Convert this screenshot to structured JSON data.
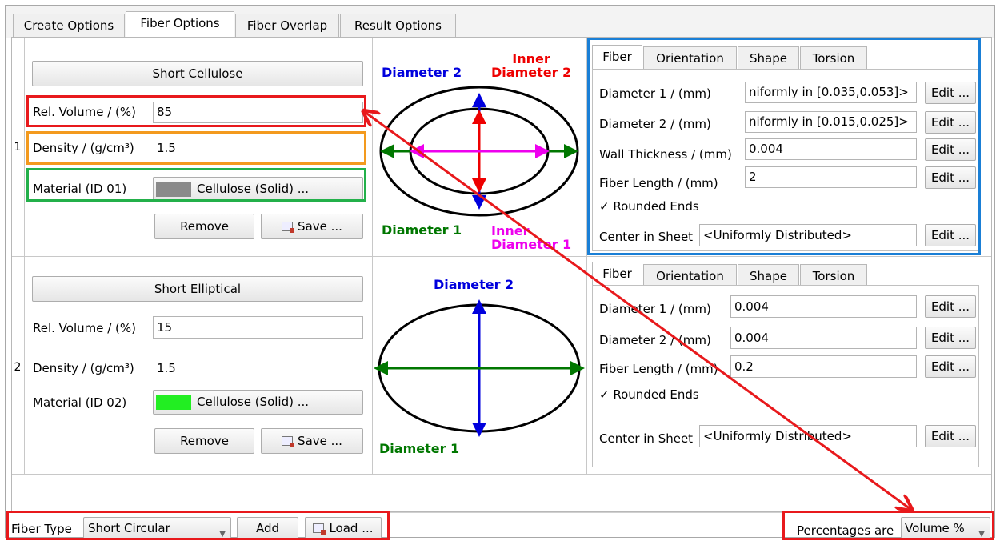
{
  "tabs": [
    "Create Options",
    "Fiber Options",
    "Fiber Overlap",
    "Result Options"
  ],
  "active_tab": "Fiber Options",
  "fibers": [
    {
      "row": "1",
      "name": "Short Cellulose",
      "rel_volume_label": "Rel. Volume / (%)",
      "rel_volume": "85",
      "density_label": "Density / (g/cm³)",
      "density": "1.5",
      "material_label": "Material (ID 01)",
      "material": "Cellulose (Solid) ...",
      "material_color": "#8a8a8a",
      "remove": "Remove",
      "save": "Save ...",
      "diagram": {
        "d2": "Diameter 2",
        "d1": "Diameter 1",
        "inner_d2": "Inner Diameter 2",
        "inner_d2_l1": "Inner",
        "inner_d2_l2": "Diameter 2",
        "inner_d1_l1": "Inner",
        "inner_d1_l2": "Diameter 1",
        "colors": {
          "d2": "#0000dd",
          "d1": "#007700",
          "inner_d2": "#ee0000",
          "inner_d1": "#ee00ee"
        }
      },
      "subtabs": [
        "Fiber",
        "Orientation",
        "Shape",
        "Torsion"
      ],
      "props": [
        {
          "label": "Diameter 1 / (mm)",
          "value": "niformly in [0.035,0.053]>",
          "edit": "Edit ..."
        },
        {
          "label": "Diameter 2 / (mm)",
          "value": "niformly in [0.015,0.025]>",
          "edit": "Edit ..."
        },
        {
          "label": "Wall Thickness / (mm)",
          "value": "0.004",
          "edit": "Edit ..."
        },
        {
          "label": "Fiber Length / (mm)",
          "value": "2",
          "edit": "Edit ..."
        }
      ],
      "rounded_ends": "Rounded Ends",
      "center_label": "Center in Sheet",
      "center_value": "<Uniformly Distributed>",
      "center_edit": "Edit ..."
    },
    {
      "row": "2",
      "name": "Short Elliptical",
      "rel_volume_label": "Rel. Volume / (%)",
      "rel_volume": "15",
      "density_label": "Density / (g/cm³)",
      "density": "1.5",
      "material_label": "Material (ID 02)",
      "material": "Cellulose (Solid) ...",
      "material_color": "#22ee22",
      "remove": "Remove",
      "save": "Save ...",
      "diagram": {
        "d2": "Diameter 2",
        "d1": "Diameter 1",
        "colors": {
          "d2": "#0000dd",
          "d1": "#007700"
        }
      },
      "subtabs": [
        "Fiber",
        "Orientation",
        "Shape",
        "Torsion"
      ],
      "props": [
        {
          "label": "Diameter 1 / (mm)",
          "value": "0.004",
          "edit": "Edit ..."
        },
        {
          "label": "Diameter 2 / (mm)",
          "value": "0.004",
          "edit": "Edit ..."
        },
        {
          "label": "Fiber Length / (mm)",
          "value": "0.2",
          "edit": "Edit ..."
        }
      ],
      "rounded_ends": "Rounded Ends",
      "center_label": "Center in Sheet",
      "center_value": "<Uniformly Distributed>",
      "center_edit": "Edit ..."
    }
  ],
  "bottom": {
    "fiber_type_label": "Fiber Type",
    "fiber_type_value": "Short Circular",
    "add": "Add",
    "load": "Load ...",
    "percentages_label": "Percentages are",
    "percentages_value": "Volume %"
  },
  "annotation_colors": {
    "red": "#e8191c",
    "orange": "#f39a1e",
    "green": "#23b04a",
    "blue": "#1a7fd6"
  }
}
